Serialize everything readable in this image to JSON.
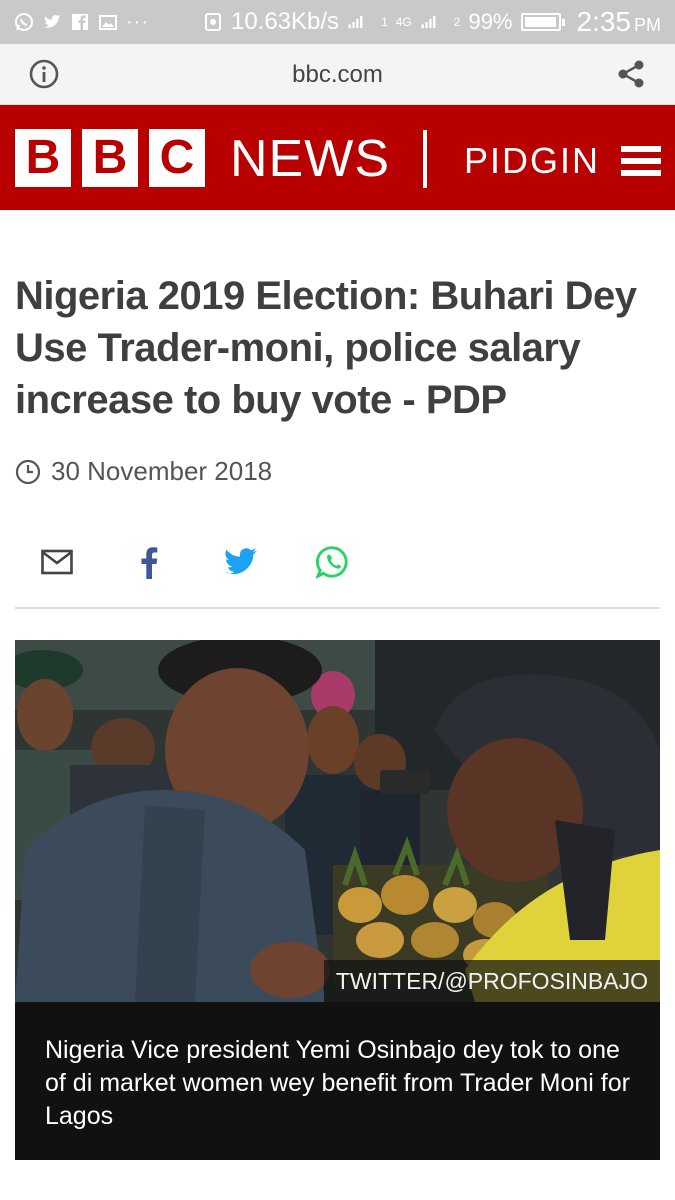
{
  "status_bar": {
    "notification_icons": [
      "whatsapp-icon",
      "twitter-icon",
      "facebook-icon",
      "gallery-icon"
    ],
    "more_indicator": "···",
    "network_speed": "10.63Kb/s",
    "sim1_label": "1",
    "sim2_label": "2",
    "network_type": "4G",
    "battery_percent_text": "99%",
    "battery_level": 0.99,
    "time": "2:35",
    "ampm": "PM"
  },
  "browser": {
    "url": "bbc.com",
    "left_icon": "info-icon",
    "right_icon": "share-icon"
  },
  "header": {
    "brand_letters": [
      "B",
      "B",
      "C"
    ],
    "news_label": "NEWS",
    "section_label": "PIDGIN",
    "menu_icon": "hamburger-menu-icon",
    "brand_color": "#b80000"
  },
  "article": {
    "headline": "Nigeria 2019 Election: Buhari Dey Use Trader-moni, police salary increase to buy vote - PDP",
    "date": "30 November 2018",
    "share_buttons": [
      "email-icon",
      "facebook-icon",
      "twitter-icon",
      "whatsapp-icon"
    ],
    "image_credit": "TWITTER/@PROFOSINBAJO",
    "image_caption": "Nigeria Vice president Yemi Osinbajo dey tok to one of di market women wey benefit from Trader Moni for Lagos"
  },
  "colors": {
    "facebook": "#3b5998",
    "twitter": "#1da1f2",
    "whatsapp": "#25d366",
    "headline_text": "#3f3f42"
  }
}
